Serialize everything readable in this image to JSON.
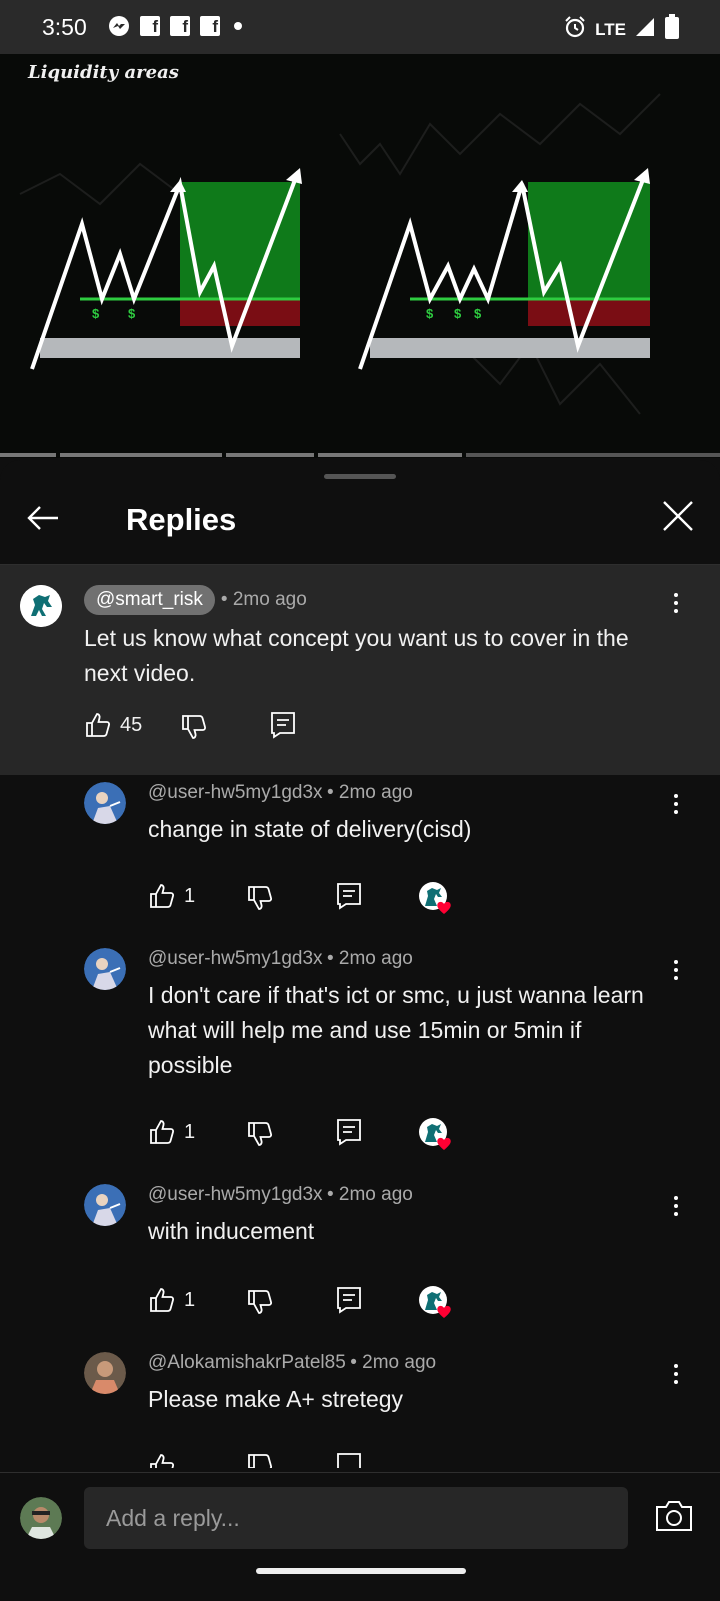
{
  "status_bar": {
    "time": "3:50",
    "network": "LTE",
    "left_icons": [
      "messenger-icon",
      "facebook-icon",
      "facebook-icon",
      "facebook-icon",
      "dot-icon"
    ],
    "right_icons": [
      "alarm-icon",
      "signal-icon",
      "battery-icon"
    ]
  },
  "video": {
    "caption": "Liquidity areas",
    "left_chart_dollars": [
      "$",
      "$"
    ],
    "right_chart_dollars": [
      "$",
      "$",
      "$"
    ]
  },
  "sheet": {
    "title": "Replies"
  },
  "top_comment": {
    "author": "@smart_risk",
    "time": "• 2mo ago",
    "text": "Let us know what concept you want us to cover in the next video.",
    "likes": "45"
  },
  "replies": [
    {
      "author": "@user-hw5my1gd3x",
      "time": "• 2mo ago",
      "text": "change in state of delivery(cisd)",
      "likes": "1",
      "hearted": true
    },
    {
      "author": "@user-hw5my1gd3x",
      "time": "• 2mo ago",
      "text": "I don't care if that's ict or smc, u just wanna learn what will help me and use 15min or 5min if possible",
      "likes": "1",
      "hearted": true
    },
    {
      "author": "@user-hw5my1gd3x",
      "time": "• 2mo ago",
      "text": "with inducement",
      "likes": "1",
      "hearted": true
    },
    {
      "author": "@AlokamishakrPatel85",
      "time": "• 2mo ago",
      "text": "Please make A+ stretegy",
      "likes": "",
      "hearted": false
    }
  ],
  "composer": {
    "placeholder": "Add a reply..."
  },
  "colors": {
    "background": "#0f0f0f",
    "highlight": "#272727",
    "pill": "#717171",
    "muted": "#aaaaaa",
    "heart": "#ff0033",
    "chart_green": "#0f7a1a",
    "chart_red": "#7a0d14"
  }
}
